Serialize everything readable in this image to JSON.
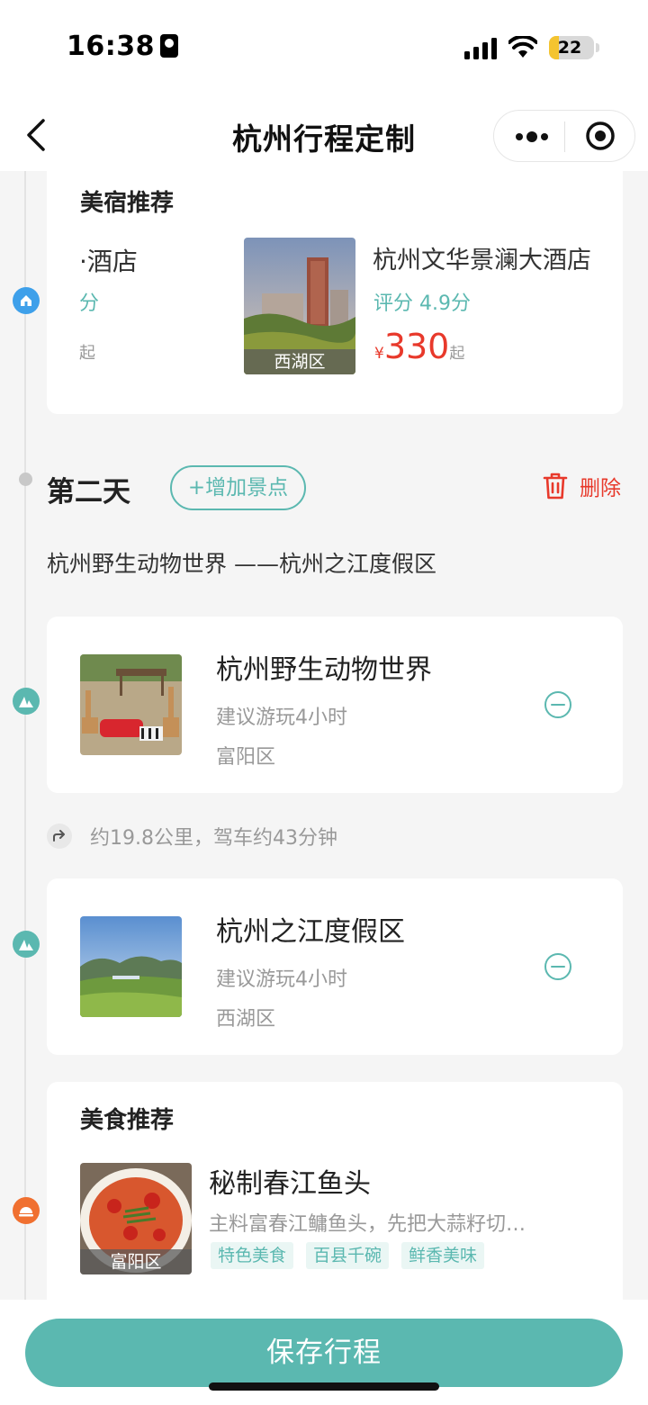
{
  "status_bar": {
    "time": "16:38",
    "battery": "22",
    "battery_level": 0.22
  },
  "header": {
    "title": "杭州行程定制"
  },
  "hotel_section": {
    "title": "美宿推荐",
    "prev_hotel": {
      "name": "·酒店",
      "score_partial": "分",
      "price_partial": "起"
    },
    "hotel": {
      "name": "杭州文华景澜大酒店",
      "area": "西湖区",
      "score": "评分 4.9分",
      "currency": "¥",
      "price": "330",
      "price_suffix": "起"
    }
  },
  "day": {
    "title": "第二天",
    "add_label": "+增加景点",
    "delete_label": "删除",
    "route": "杭州野生动物世界 ——杭州之江度假区"
  },
  "spots": [
    {
      "name": "杭州野生动物世界",
      "duration": "建议游玩4小时",
      "district": "富阳区"
    },
    {
      "name": "杭州之江度假区",
      "duration": "建议游玩4小时",
      "district": "西湖区"
    }
  ],
  "drive_info": "约19.8公里，驾车约43分钟",
  "food_section": {
    "title": "美食推荐",
    "item": {
      "name": "秘制春江鱼头",
      "area": "富阳区",
      "desc": "主料富春江鳙鱼头，先把大蒜籽切…",
      "tags": [
        "特色美食",
        "百县千碗",
        "鲜香美味"
      ]
    }
  },
  "save_label": "保存行程",
  "colors": {
    "accent": "#5bb8b0",
    "danger": "#e8392b",
    "hotel_marker": "#3ea0ea",
    "food_marker": "#f07030"
  }
}
